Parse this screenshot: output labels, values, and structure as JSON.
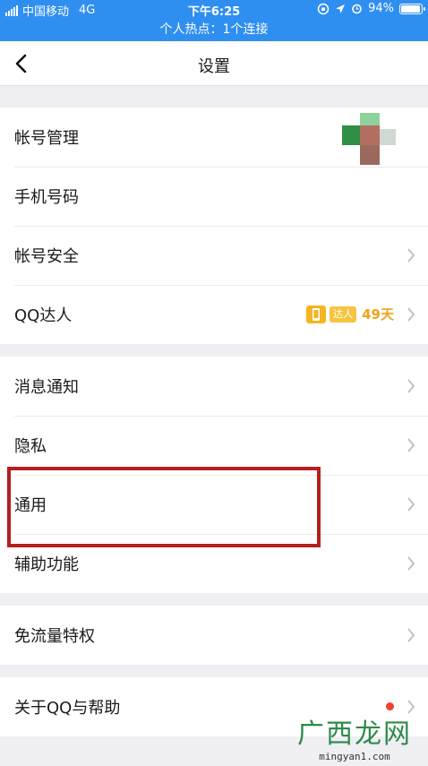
{
  "status_bar": {
    "carrier": "中国移动",
    "network": "4G",
    "time": "下午6:25",
    "battery": "94%",
    "battery_level": 0.94,
    "hotspot": "个人热点：1个连接"
  },
  "nav": {
    "title": "设置",
    "back_icon": "chevron-left-icon"
  },
  "groups": [
    {
      "items": [
        {
          "label": "帐号管理"
        },
        {
          "label": "手机号码"
        },
        {
          "label": "帐号安全"
        },
        {
          "label": "QQ达人",
          "badge": "达人",
          "days": "49天"
        }
      ]
    },
    {
      "items": [
        {
          "label": "消息通知"
        },
        {
          "label": "隐私"
        },
        {
          "label": "通用",
          "highlighted": true
        },
        {
          "label": "辅助功能"
        }
      ]
    },
    {
      "items": [
        {
          "label": "免流量特权"
        }
      ]
    },
    {
      "items": [
        {
          "label": "关于QQ与帮助"
        }
      ]
    }
  ],
  "colors": {
    "status_bar": "#2f8ff0",
    "highlight_border": "#b4201f",
    "daren_gold": "#f0a51a",
    "notification_dot": "#f2412f"
  },
  "watermark": {
    "brand": "广西龙网",
    "url": "mingyan1.com"
  }
}
